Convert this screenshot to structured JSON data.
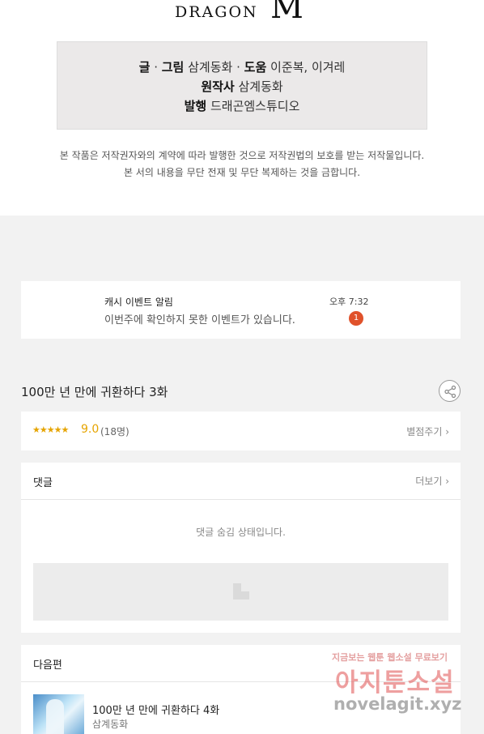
{
  "logo": {
    "text": "DRAGON",
    "mark": "M"
  },
  "credits": {
    "line1": {
      "label_a": "글",
      "sep1": " · ",
      "label_b": "그림",
      "value_a": " 삼계동화",
      "sep2": " · ",
      "label_c": "도움",
      "value_c": " 이준복, 이겨레"
    },
    "line2": {
      "label": "원작사",
      "value": " 삼계동화"
    },
    "line3": {
      "label": "발행",
      "value": " 드래곤엠스튜디오"
    }
  },
  "notice": {
    "line1": "본 작품은 저작권자와의 계약에 따라 발행한 것으로 저작권법의 보호를 받는 저작물입니다.",
    "line2": "본 서의 내용을 무단 전재 및 무단 복제하는 것을 금합니다."
  },
  "event": {
    "title": "캐시 이벤트 알림",
    "text": "이번주에 확인하지 못한 이벤트가 있습니다.",
    "time": "오후 7:32",
    "badge": "1"
  },
  "episode": {
    "title": "100만 년 만에 귀환하다 3화",
    "share_icon": "share-icon"
  },
  "rating": {
    "stars": "★★★★★",
    "score": "9.0",
    "count": "(18명)",
    "rate_button": "별점주기 ›"
  },
  "comments": {
    "header": "댓글",
    "more": "더보기 ›",
    "hidden_text": "댓글 숨김 상태입니다."
  },
  "next": {
    "header": "다음편",
    "title": "100만 년 만에 귀환하다 4화",
    "author": "삼계동화"
  },
  "watermark": {
    "top": "지금보는 웹툰 웹소설 무료보기",
    "main": "아지툰소설",
    "url": "novelagit.xyz"
  },
  "colors": {
    "accent_star": "#e6a400",
    "badge": "#e0522b",
    "page_bg": "#f2f2f2"
  }
}
